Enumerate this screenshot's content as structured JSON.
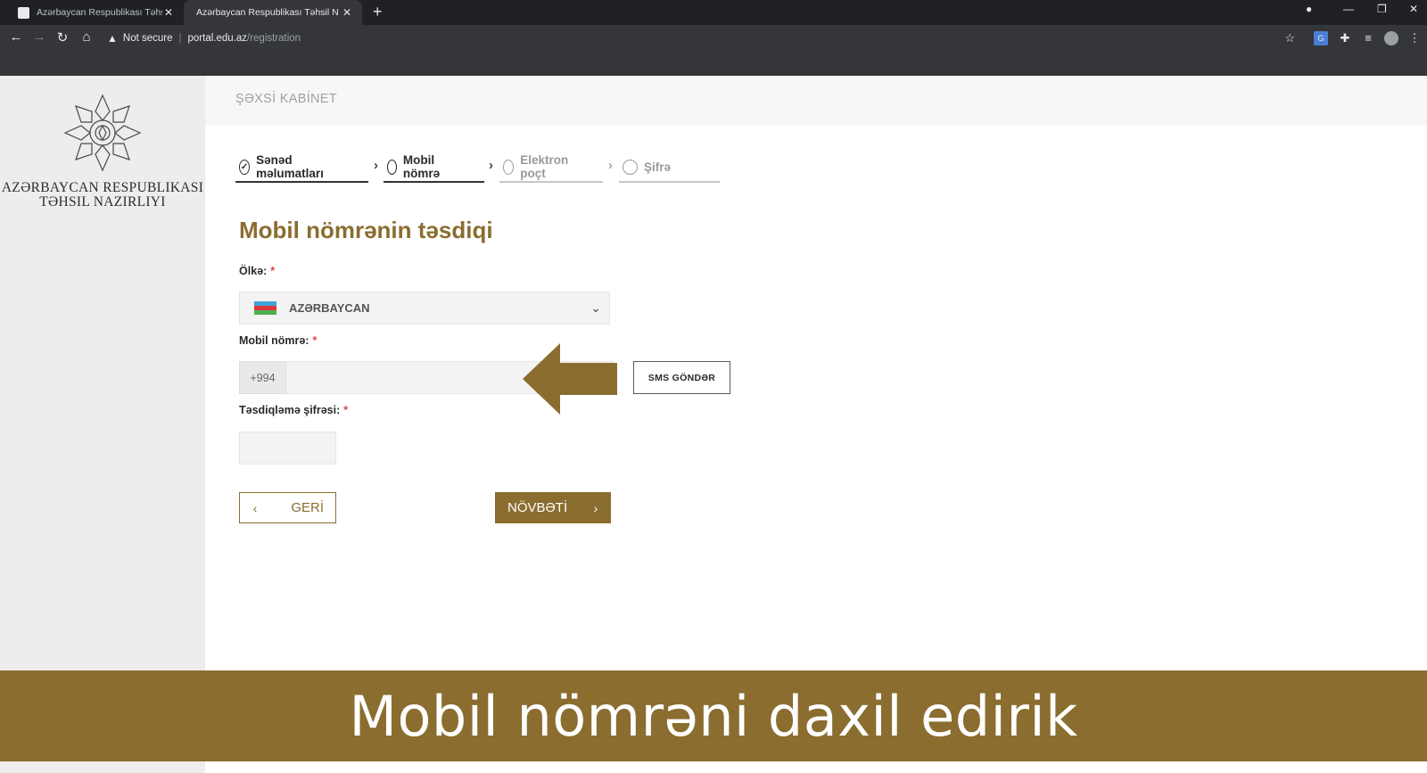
{
  "browser": {
    "tabs": [
      {
        "title": "Azərbaycan Respublikası Təhsil N",
        "active": false
      },
      {
        "title": "Azərbaycan Respublikası Təhsil N",
        "active": true
      }
    ],
    "security_label": "Not secure",
    "url_host": "portal.edu.az",
    "url_path": "/registration"
  },
  "sidebar": {
    "ministry_line1": "Azərbaycan Respublikası",
    "ministry_line2": "Təhsil Nazirliyi"
  },
  "header": {
    "title": "ŞƏXSİ KABİNET"
  },
  "steps": [
    {
      "label": "Sənəd məlumatları",
      "state": "done"
    },
    {
      "label": "Mobil nömrə",
      "state": "active"
    },
    {
      "label": "Elektron poçt",
      "state": "pending"
    },
    {
      "label": "Şifrə",
      "state": "pending"
    }
  ],
  "form": {
    "title": "Mobil nömrənin təsdiqi",
    "country_label": "Ölkə:",
    "required_mark": "*",
    "country_value": "AZƏRBAYCAN",
    "phone_label": "Mobil nömrə:",
    "phone_prefix": "+994",
    "phone_value": "",
    "sms_button": "SMS GÖNDƏR",
    "code_label": "Təsdiqləmə şifrəsi:",
    "code_value": "",
    "back_button": "GERİ",
    "next_button": "NÖVBƏTİ"
  },
  "caption": {
    "text": "Mobil nömrəni daxil edirik"
  },
  "colors": {
    "accent": "#8a6d2f",
    "banner": "#8a6d2f",
    "flag_blue": "#3ea3d6",
    "flag_red": "#e0363a",
    "flag_green": "#4caf50"
  }
}
